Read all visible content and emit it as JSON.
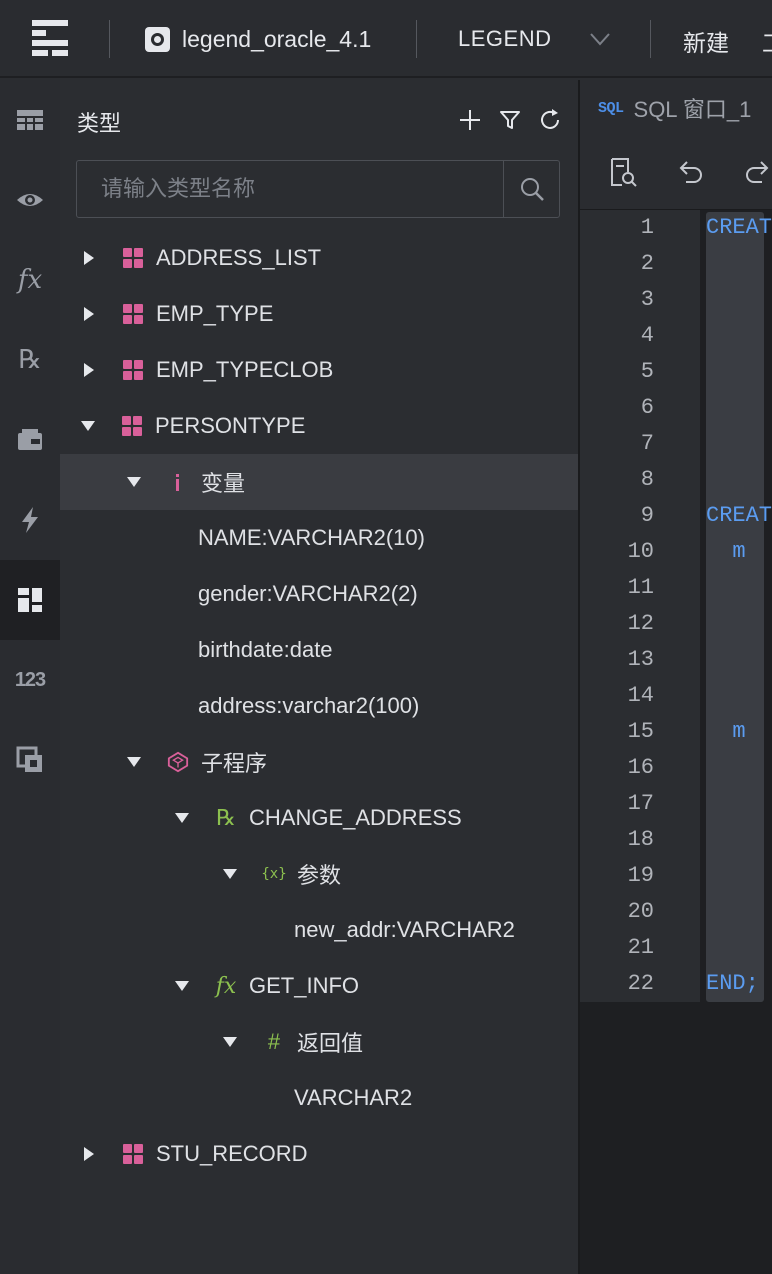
{
  "topbar": {
    "connection_name": "legend_oracle_4.1",
    "schema": "LEGEND",
    "new_label": "新建",
    "cut_label": "工"
  },
  "rail": {
    "items": [
      {
        "icon": "table-grid-icon"
      },
      {
        "icon": "eye-icon"
      },
      {
        "icon": "function-icon",
        "glyph": "fx"
      },
      {
        "icon": "procedure-icon",
        "glyph": "℞"
      },
      {
        "icon": "package-icon"
      },
      {
        "icon": "trigger-bolt-icon"
      },
      {
        "icon": "type-icon",
        "active": true
      },
      {
        "icon": "sequence-icon",
        "glyph": "123"
      },
      {
        "icon": "synonym-icon"
      }
    ]
  },
  "panel": {
    "title": "类型",
    "search_placeholder": "请输入类型名称"
  },
  "tree": [
    {
      "label": "ADDRESS_LIST"
    },
    {
      "label": "EMP_TYPE"
    },
    {
      "label": "EMP_TYPECLOB"
    },
    {
      "label": "PERSONTYPE"
    },
    {
      "label": "变量"
    },
    {
      "label": "NAME:VARCHAR2(10)"
    },
    {
      "label": "gender:VARCHAR2(2)"
    },
    {
      "label": "birthdate:date"
    },
    {
      "label": "address:varchar2(100)"
    },
    {
      "label": "子程序"
    },
    {
      "label": "CHANGE_ADDRESS"
    },
    {
      "label": "参数"
    },
    {
      "label": "new_addr:VARCHAR2"
    },
    {
      "label": "GET_INFO"
    },
    {
      "label": "返回值"
    },
    {
      "label": "VARCHAR2"
    },
    {
      "label": "STU_RECORD"
    }
  ],
  "editor": {
    "tab_badge": "SQL",
    "tab_label": "SQL 窗口_1",
    "line_numbers": [
      "1",
      "2",
      "3",
      "4",
      "5",
      "6",
      "7",
      "8",
      "9",
      "10",
      "11",
      "12",
      "13",
      "14",
      "15",
      "16",
      "17",
      "18",
      "19",
      "20",
      "21",
      "22"
    ],
    "lines": [
      "CREAT",
      "",
      "",
      "",
      "",
      "",
      "",
      "",
      "CREAT",
      "  m",
      "",
      "",
      "",
      "",
      "  m",
      "",
      "",
      "",
      "",
      "",
      "",
      "END;"
    ]
  },
  "colors": {
    "type_icon": "#d9609a",
    "func_icon": "#8cc04f",
    "keyword": "#5b9cf0"
  }
}
